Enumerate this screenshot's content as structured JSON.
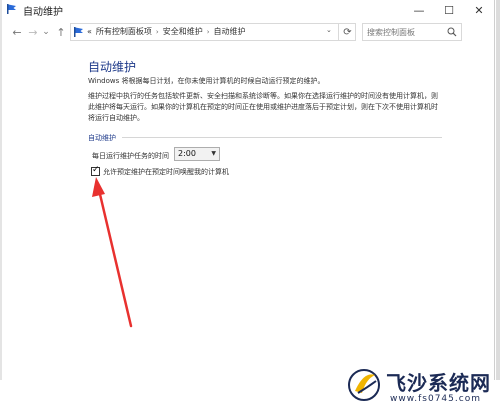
{
  "window": {
    "title": "自动维护"
  },
  "title_buttons": {
    "minimize": "—",
    "maximize": "☐",
    "close": "✕"
  },
  "nav": {
    "back_icon": "←",
    "forward_icon": "→",
    "dropdown_icon": "⌄",
    "up_icon": "↑"
  },
  "address": {
    "prefix": "«",
    "crumbs": [
      "所有控制面板项",
      "安全和维护",
      "自动维护"
    ],
    "separator": "›",
    "dropdown": "⌄",
    "refresh": "⟳"
  },
  "search": {
    "placeholder": "搜索控制面板"
  },
  "content": {
    "title": "自动维护",
    "intro": "Windows 将根据每日计划，在你未使用计算机的时候自动运行预定的维护。",
    "description": "维护过程中执行的任务包括软件更新、安全扫描和系统诊断等。如果你在选择运行维护的时间没有使用计算机，则此维护将每天运行。如果你的计算机在预定的时间正在使用或维护进度落后于预定计划，则在下次不使用计算机时将运行自动维护。",
    "section_label": "自动维护",
    "time_label": "每日运行维护任务的时间",
    "time_value": "2:00",
    "wake_checked": true,
    "wake_label": "允许预定维护在预定时间唤醒我的计算机"
  },
  "watermark": {
    "name": "飞沙系统网",
    "url": "www.fs0745.com"
  },
  "colors": {
    "title": "#1e3a8a",
    "arrow": "#e8312f",
    "watermark": "#1b2a55"
  }
}
